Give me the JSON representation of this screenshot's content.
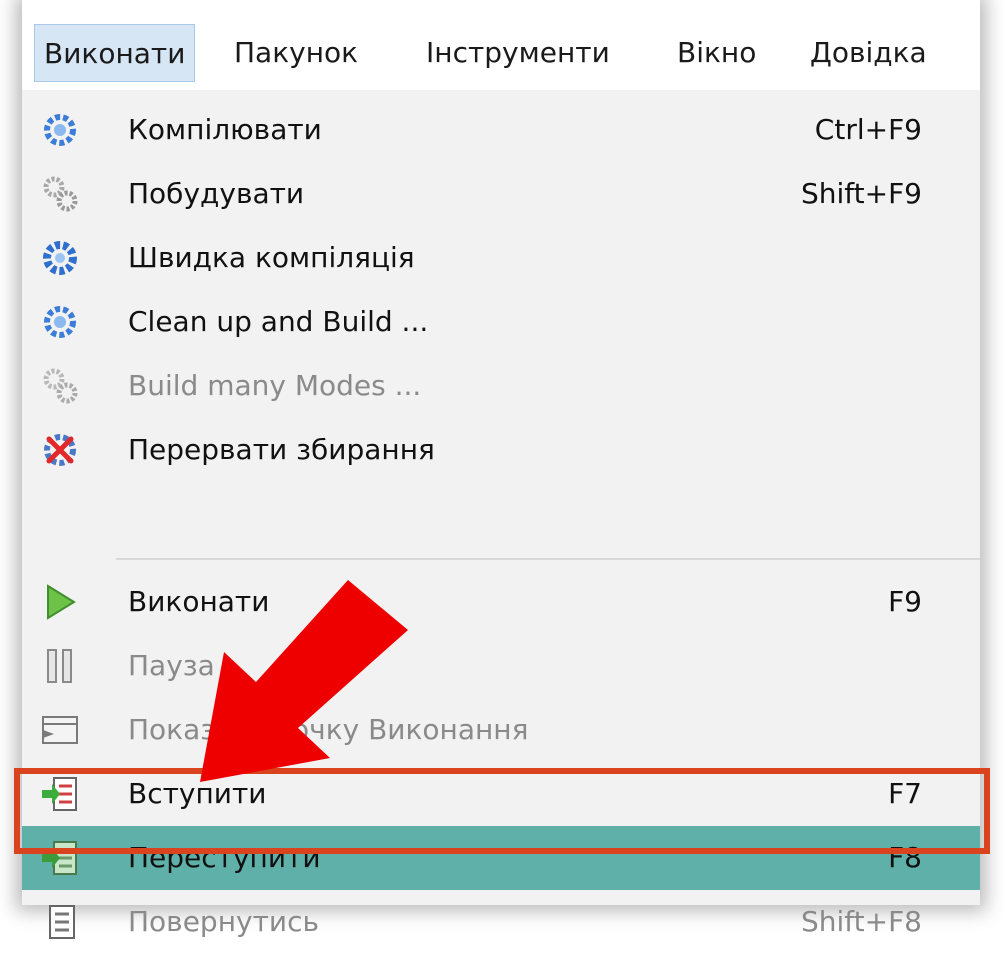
{
  "menubar": {
    "items": [
      {
        "label": "Виконати",
        "active": true
      },
      {
        "label": "Пакунок"
      },
      {
        "label": "Інструменти"
      },
      {
        "label": "Вікно"
      },
      {
        "label": "Довідка"
      }
    ]
  },
  "menu": {
    "items": [
      {
        "label": "Компілювати",
        "shortcut": "Ctrl+F9",
        "icon": "gear-blue-icon"
      },
      {
        "label": "Побудувати",
        "shortcut": "Shift+F9",
        "icon": "gears-gray-icon"
      },
      {
        "label": "Швидка компіляція",
        "shortcut": "",
        "icon": "gear-blue-bold-icon"
      },
      {
        "label": "Clean up and Build ...",
        "shortcut": "",
        "icon": "gear-blue-icon"
      },
      {
        "label": "Build many Modes ...",
        "shortcut": "",
        "icon": "gears-gray-icon",
        "disabled": true
      },
      {
        "label": "Перервати збирання",
        "shortcut": "",
        "icon": "abort-build-icon"
      },
      {
        "label": "Виконати",
        "shortcut": "F9",
        "icon": "play-icon"
      },
      {
        "label": "Пауза",
        "shortcut": "",
        "icon": "pause-icon",
        "disabled": true
      },
      {
        "label": "Показати точку Виконання",
        "shortcut": "",
        "icon": "show-execution-point-icon",
        "disabled": true
      },
      {
        "label": "Вступити",
        "shortcut": "F7",
        "icon": "step-into-icon"
      },
      {
        "label": "Переступити",
        "shortcut": "F8",
        "icon": "step-over-icon",
        "highlighted": true
      },
      {
        "label": "Повернутись",
        "shortcut": "Shift+F8",
        "icon": "step-out-icon",
        "disabled": true
      }
    ]
  },
  "colors": {
    "highlight": "#5fb0a8",
    "annotation": "#d9441f",
    "arrow": "#ee0000"
  }
}
